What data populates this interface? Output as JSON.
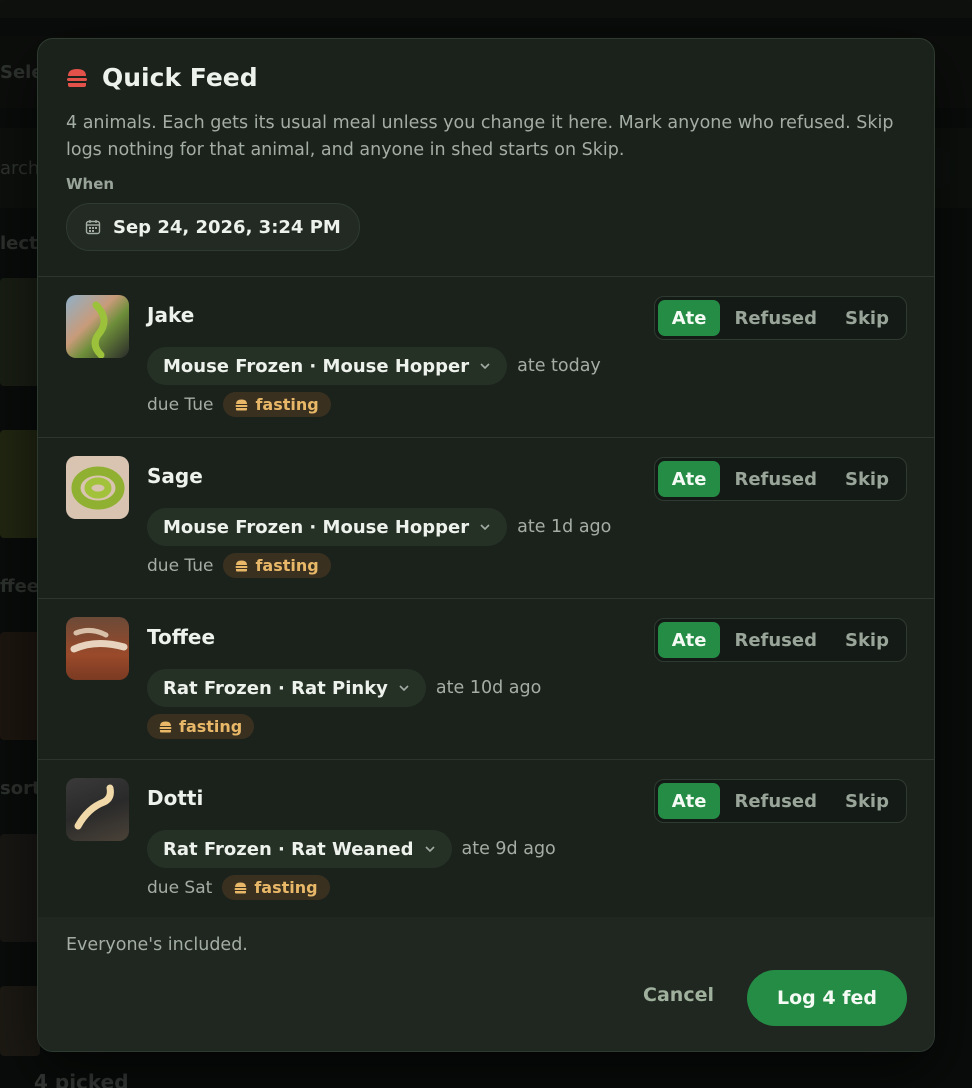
{
  "background": {
    "frag_select": "Sele",
    "frag_search": "arch",
    "frag_select2": "lect",
    "frag_toffee": "ffee",
    "frag_sort": "sort",
    "picked": "4 picked"
  },
  "modal": {
    "title": "Quick Feed",
    "title_icon": "burger-icon",
    "description": "4 animals. Each gets its usual meal unless you change it here. Mark anyone who refused. Skip logs nothing for that animal, and anyone in shed starts on Skip.",
    "when_label": "When",
    "when_value": "Sep 24, 2026, 3:24 PM",
    "segment_labels": {
      "ate": "Ate",
      "refused": "Refused",
      "skip": "Skip"
    },
    "fasting_label": "fasting",
    "animals": [
      {
        "name": "Jake",
        "meal": "Mouse Frozen · Mouse Hopper",
        "last_fed": "ate today",
        "due": "due Tue",
        "fasting": true,
        "selected": "Ate"
      },
      {
        "name": "Sage",
        "meal": "Mouse Frozen · Mouse Hopper",
        "last_fed": "ate 1d ago",
        "due": "due Tue",
        "fasting": true,
        "selected": "Ate"
      },
      {
        "name": "Toffee",
        "meal": "Rat Frozen · Rat Pinky",
        "last_fed": "ate 10d ago",
        "due": "",
        "fasting": true,
        "selected": "Ate"
      },
      {
        "name": "Dotti",
        "meal": "Rat Frozen · Rat Weaned",
        "last_fed": "ate 9d ago",
        "due": "due Sat",
        "fasting": true,
        "selected": "Ate"
      }
    ],
    "footer_note": "Everyone's included.",
    "cancel_label": "Cancel",
    "submit_label": "Log 4 fed"
  },
  "colors": {
    "accent": "#248c45",
    "fasting_text": "#e8b868",
    "burger": "#e2524a"
  }
}
